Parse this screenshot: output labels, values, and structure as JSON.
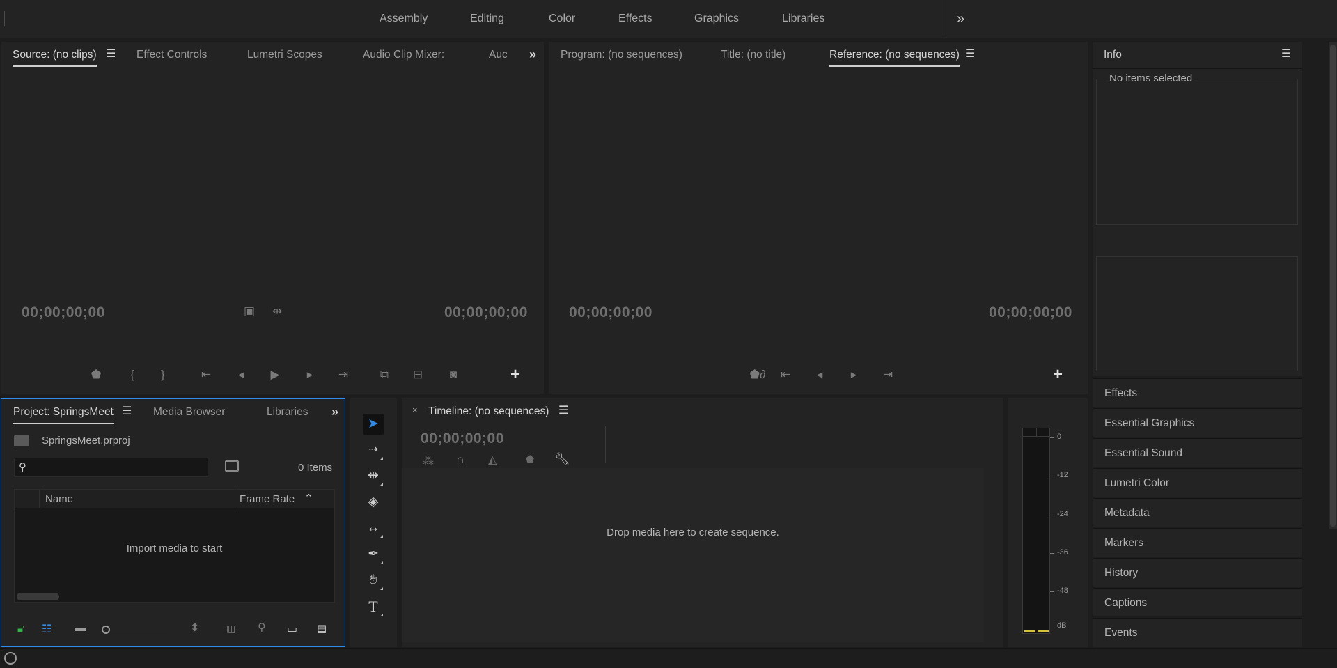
{
  "workspaces": [
    "Assembly",
    "Editing",
    "Color",
    "Effects",
    "Graphics",
    "Libraries"
  ],
  "more_workspaces_icon": "double-chevron-right",
  "source_panel": {
    "tabs": [
      "Source: (no clips)",
      "Effect Controls",
      "Lumetri Scopes",
      "Audio Clip Mixer:",
      "Auc"
    ],
    "timecode_in": "00;00;00;00",
    "timecode_out": "00;00;00;00"
  },
  "program_panel": {
    "tabs": [
      "Program: (no sequences)",
      "Title: (no title)",
      "Reference: (no sequences)"
    ],
    "timecode_in": "00;00;00;00",
    "timecode_out": "00;00;00;00"
  },
  "info_panel": {
    "title": "Info",
    "status": "No items selected"
  },
  "side_panels": [
    "Effects",
    "Essential Graphics",
    "Essential Sound",
    "Lumetri Color",
    "Metadata",
    "Markers",
    "History",
    "Captions",
    "Events"
  ],
  "project_panel": {
    "tabs": [
      "Project: SpringsMeet",
      "Media Browser",
      "Libraries"
    ],
    "file_name": "SpringsMeet.prproj",
    "item_count": "0 Items",
    "columns": [
      "Name",
      "Frame Rate"
    ],
    "empty_message": "Import media to start",
    "search_placeholder": ""
  },
  "timeline_panel": {
    "close": "×",
    "title": "Timeline: (no sequences)",
    "timecode": "00;00;00;00",
    "drop_message": "Drop media here to create sequence."
  },
  "audio_meter": {
    "labels": [
      "0",
      "-12",
      "-24",
      "-36",
      "-48",
      "dB"
    ]
  },
  "colors": {
    "accent_blue": "#2d8ceb",
    "lock_green": "#33b34a",
    "panel_bg": "#232323",
    "app_bg": "#1d1d1d"
  }
}
